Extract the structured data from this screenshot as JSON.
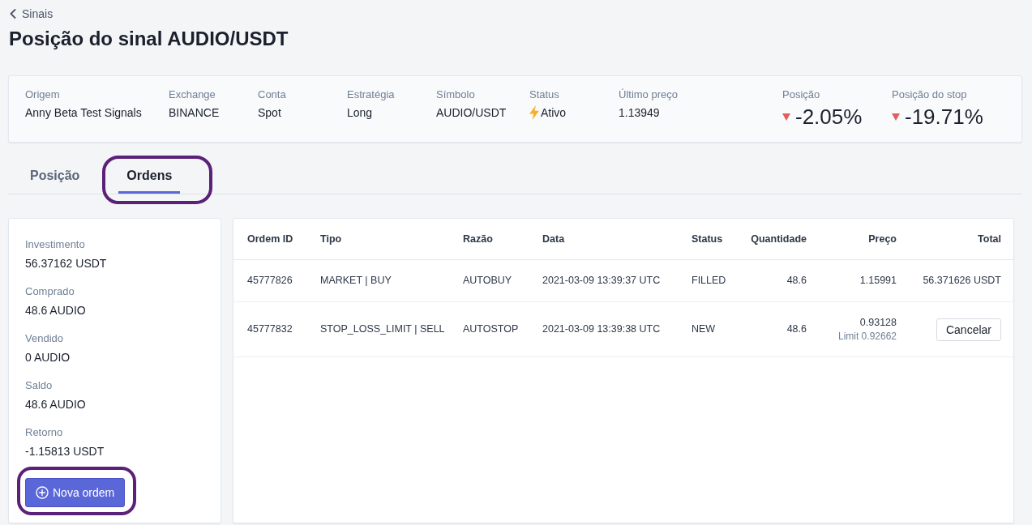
{
  "back_link": {
    "label": "Sinais"
  },
  "title": "Posição do sinal AUDIO/USDT",
  "summary": {
    "fields": [
      {
        "label": "Origem",
        "value": "Anny Beta Test Signals",
        "kind": "text"
      },
      {
        "label": "Exchange",
        "value": "BINANCE",
        "kind": "text"
      },
      {
        "label": "Conta",
        "value": "Spot",
        "kind": "text"
      },
      {
        "label": "Estratégia",
        "value": "Long",
        "kind": "text"
      },
      {
        "label": "Símbolo",
        "value": "AUDIO/USDT",
        "kind": "text"
      },
      {
        "label": "Status",
        "value": "Ativo",
        "kind": "status"
      },
      {
        "label": "Último preço",
        "value": "1.13949",
        "kind": "text"
      }
    ],
    "metrics": [
      {
        "label": "Posição",
        "value": "-2.05%",
        "negative": true
      },
      {
        "label": "Posição do stop",
        "value": "-19.71%",
        "negative": true
      }
    ]
  },
  "tabs": [
    {
      "label": "Posição",
      "selected": false,
      "highlighted": false
    },
    {
      "label": "Ordens",
      "selected": true,
      "highlighted": true
    }
  ],
  "stats": [
    {
      "label": "Investimento",
      "value": "56.37162 USDT"
    },
    {
      "label": "Comprado",
      "value": "48.6 AUDIO"
    },
    {
      "label": "Vendido",
      "value": "0 AUDIO"
    },
    {
      "label": "Saldo",
      "value": "48.6 AUDIO"
    },
    {
      "label": "Retorno",
      "value": "-1.15813 USDT"
    }
  ],
  "new_order_button": {
    "label": "Nova ordem",
    "highlighted": true
  },
  "orders": {
    "columns": [
      "Ordem ID",
      "Tipo",
      "Razão",
      "Data",
      "Status",
      "Quantidade",
      "Preço",
      "Total"
    ],
    "rows": [
      {
        "order_id": "45777826",
        "type": "MARKET | BUY",
        "reason": "AUTOBUY",
        "date": "2021-03-09 13:39:37 UTC",
        "status": "FILLED",
        "quantity": "48.6",
        "price": "1.15991",
        "total": "56.371626 USDT"
      },
      {
        "order_id": "45777832",
        "type": "STOP_LOSS_LIMIT | SELL",
        "reason": "AUTOSTOP",
        "date": "2021-03-09 13:39:38 UTC",
        "status": "NEW",
        "quantity": "48.6",
        "price": "0.93128",
        "limit_price": "Limit 0.92662",
        "cancel_button": "Cancelar"
      }
    ]
  }
}
